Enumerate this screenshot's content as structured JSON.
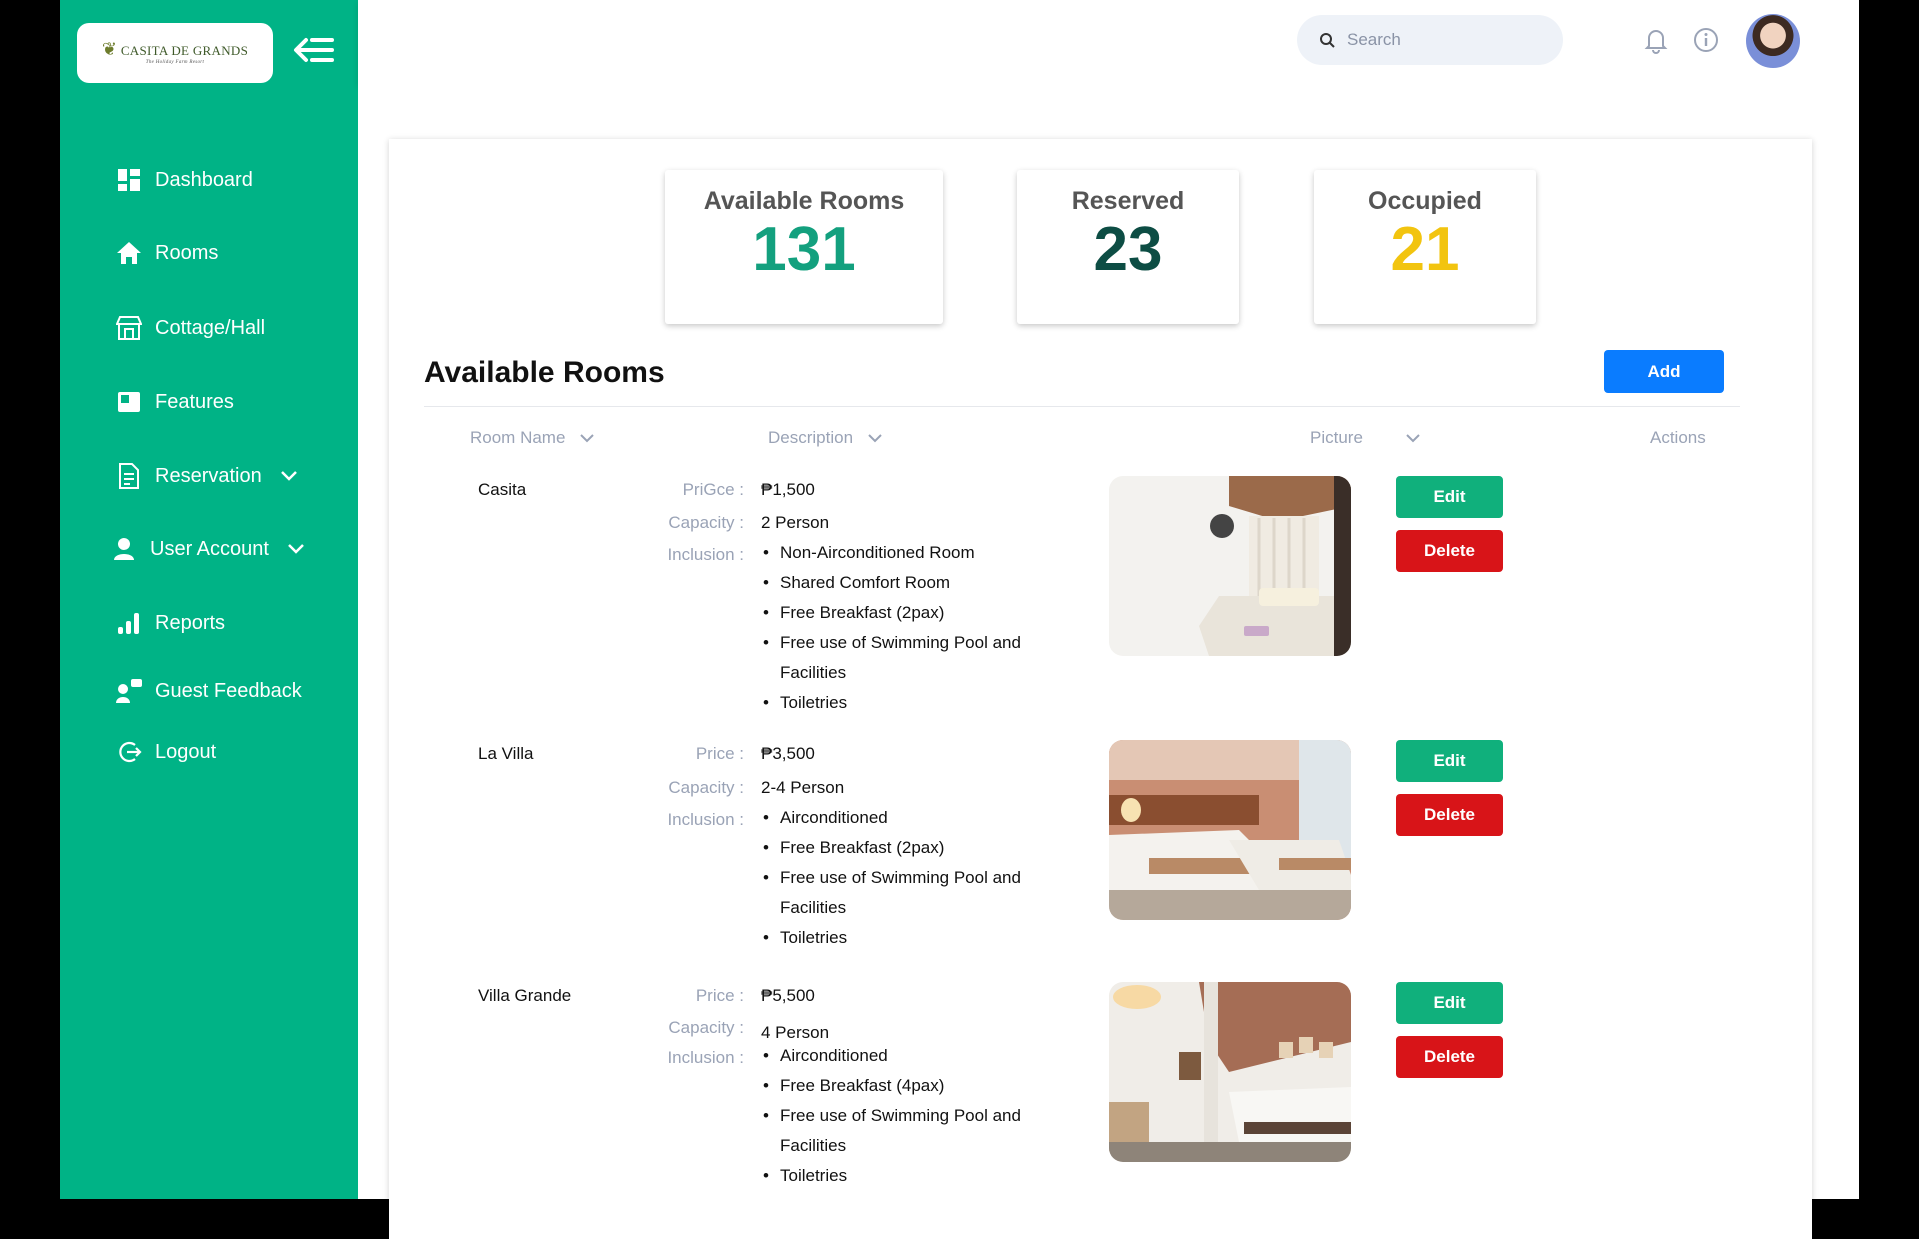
{
  "brand": {
    "name": "CASITA DE GRANDS",
    "tagline": "The Holiday Farm Resort"
  },
  "sidebar": {
    "items": [
      {
        "label": "Dashboard",
        "icon": "dashboard-icon"
      },
      {
        "label": "Rooms",
        "icon": "home-icon"
      },
      {
        "label": "Cottage/Hall",
        "icon": "store-icon"
      },
      {
        "label": "Features",
        "icon": "features-icon"
      },
      {
        "label": "Reservation",
        "icon": "document-icon",
        "expandable": true
      },
      {
        "label": "User Account",
        "icon": "user-icon",
        "expandable": true
      },
      {
        "label": "Reports",
        "icon": "bar-chart-icon"
      },
      {
        "label": "Guest Feedback",
        "icon": "feedback-icon"
      },
      {
        "label": "Logout",
        "icon": "logout-icon"
      }
    ]
  },
  "header": {
    "search_placeholder": "Search"
  },
  "stats": [
    {
      "label": "Available Rooms",
      "value": "131",
      "color": "#13a07e"
    },
    {
      "label": "Reserved",
      "value": "23",
      "color": "#0d4d44"
    },
    {
      "label": "Occupied",
      "value": "21",
      "color": "#f2c40f"
    }
  ],
  "main": {
    "title": "Available Rooms",
    "add_label": "Add",
    "columns": [
      "Room Name",
      "Description",
      "Picture",
      "Actions"
    ],
    "edit_label": "Edit",
    "delete_label": "Delete",
    "rooms": [
      {
        "name": "Casita",
        "price_label": "PriGce :",
        "price": "₱1,500",
        "capacity_label": "Capacity :",
        "capacity": "2 Person",
        "inclusion_label": "Inclusion :",
        "inclusions": [
          "Non-Airconditioned Room",
          "Shared Comfort Room",
          "Free Breakfast (2pax)",
          "Free use of Swimming Pool and Facilities",
          "Toiletries"
        ]
      },
      {
        "name": "La Villa",
        "price_label": "Price :",
        "price": "₱3,500",
        "capacity_label": "Capacity :",
        "capacity": "2-4 Person",
        "inclusion_label": "Inclusion :",
        "inclusions": [
          "Airconditioned",
          "Free Breakfast (2pax)",
          "Free use of Swimming Pool and Facilities",
          "Toiletries"
        ]
      },
      {
        "name": "Villa Grande",
        "price_label": "Price :",
        "price": "₱5,500",
        "capacity_label": "Capacity :",
        "capacity": "4 Person",
        "inclusion_label": "Inclusion :",
        "inclusions": [
          "Airconditioned",
          "Free Breakfast (4pax)",
          "Free use of Swimming Pool and Facilities",
          "Toiletries"
        ]
      }
    ]
  },
  "colors": {
    "sidebar": "#00b386",
    "accent_blue": "#0a7cff",
    "edit_green": "#10b07c",
    "delete_red": "#d81418"
  }
}
